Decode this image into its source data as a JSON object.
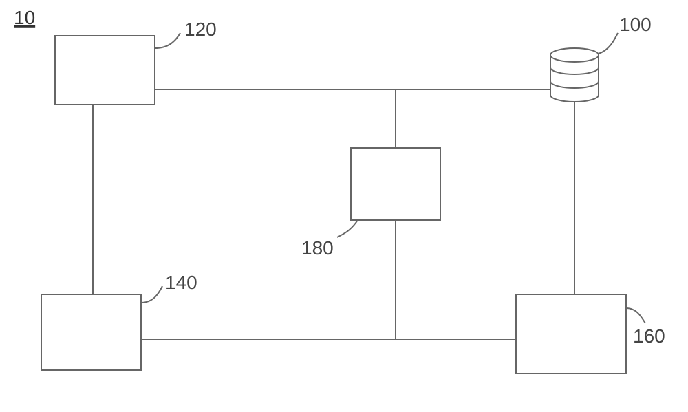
{
  "figure_id": "10",
  "labels": {
    "db": "100",
    "b120": "120",
    "b140": "140",
    "b160": "160",
    "b180": "180"
  }
}
